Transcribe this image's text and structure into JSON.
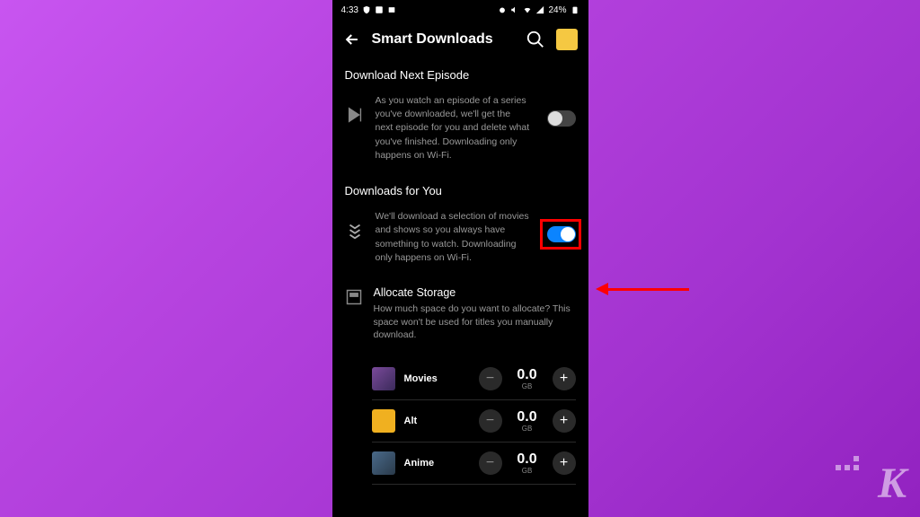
{
  "status": {
    "time": "4:33",
    "battery": "24%"
  },
  "header": {
    "title": "Smart Downloads"
  },
  "section1": {
    "title": "Download Next Episode",
    "description": "As you watch an episode of a series you've downloaded, we'll get the next episode for you and delete what you've finished. Downloading only happens on Wi-Fi."
  },
  "section2": {
    "title": "Downloads for You",
    "description": "We'll download a selection of movies and shows so you always have something to watch. Downloading only happens on Wi-Fi."
  },
  "allocate": {
    "title": "Allocate Storage",
    "description": "How much space do you want to allocate? This space won't be used for titles you manually download."
  },
  "categories": [
    {
      "name": "Movies",
      "value": "0.0",
      "unit": "GB"
    },
    {
      "name": "Alt",
      "value": "0.0",
      "unit": "GB"
    },
    {
      "name": "Anime",
      "value": "0.0",
      "unit": "GB"
    }
  ],
  "watermark": "K"
}
